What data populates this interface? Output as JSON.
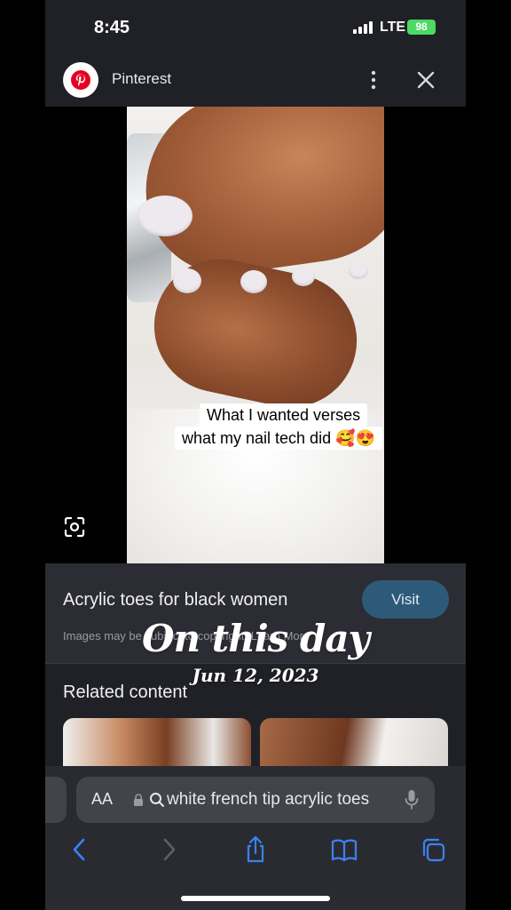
{
  "status_bar": {
    "time": "8:45",
    "network": "LTE",
    "battery": "98"
  },
  "header": {
    "site_name": "Pinterest"
  },
  "image": {
    "caption_line1": "What I wanted verses",
    "caption_line2": "what my nail tech did 🥰😍"
  },
  "pin": {
    "title": "Acrylic toes for black women",
    "visit_label": "Visit",
    "disclaimer": "Images may be subject to copyright. Learn More"
  },
  "related": {
    "title": "Related content"
  },
  "overlay": {
    "title": "On this day",
    "date": "Jun 12, 2023"
  },
  "toolbar": {
    "aa_label": "AA",
    "url_text": "white french tip acrylic toes"
  },
  "colors": {
    "accent": "#2e5a7a",
    "battery": "#4cd964",
    "link": "#3b82f6"
  },
  "icons": [
    "pinterest-logo",
    "more-icon",
    "close-icon",
    "lens-icon",
    "lock-icon",
    "search-icon",
    "mic-icon",
    "back-icon",
    "forward-icon",
    "share-icon",
    "bookmarks-icon",
    "tabs-icon"
  ]
}
